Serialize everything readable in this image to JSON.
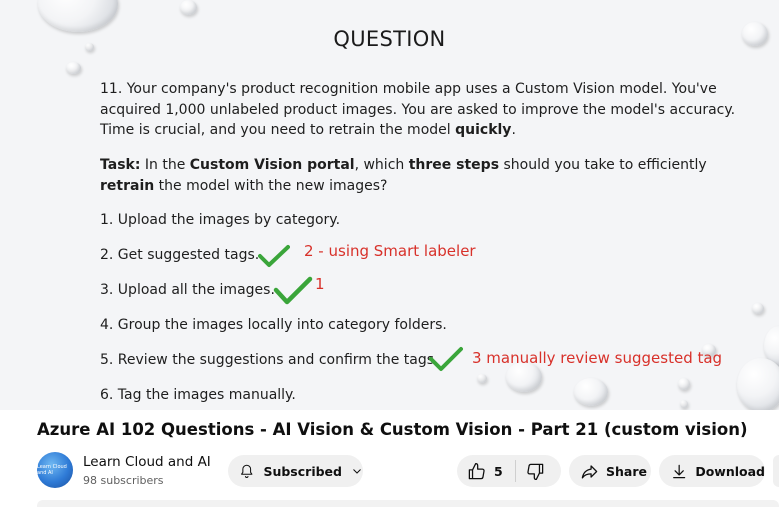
{
  "video_frame": {
    "heading": "QUESTION",
    "question_parts": [
      {
        "text": "11. Your company's product recognition mobile app uses a Custom Vision model. You've acquired 1,000 unlabeled product images. You are asked to improve the model's accuracy. Time is crucial, and you need to retrain the model ",
        "bold": false
      },
      {
        "text": "quickly",
        "bold": true
      },
      {
        "text": ".",
        "bold": false
      }
    ],
    "task_parts": [
      {
        "text": "Task:",
        "bold": true
      },
      {
        "text": " In the ",
        "bold": false
      },
      {
        "text": "Custom Vision portal",
        "bold": true
      },
      {
        "text": ", which ",
        "bold": false
      },
      {
        "text": "three steps",
        "bold": true
      },
      {
        "text": " should you take to efficiently ",
        "bold": false
      },
      {
        "text": "retrain",
        "bold": true
      },
      {
        "text": " the model with the new images?",
        "bold": false
      }
    ],
    "steps": [
      "1. Upload the images by category.",
      "2.  Get suggested tags.",
      "3.  Upload all the images.",
      "4.  Group the images locally into category folders.",
      "5.  Review the suggestions and confirm the tags.",
      "6.  Tag the images manually."
    ],
    "annotations": {
      "step2": "2 - using Smart labeler",
      "step3": "1",
      "step5": "3 manually review suggested tag"
    },
    "check_color": "#3aa53a",
    "note_color": "#d8312a"
  },
  "video_title": "Azure AI 102 Questions - AI Vision & Custom Vision - Part 21 (custom vision)",
  "channel": {
    "name": "Learn Cloud and AI",
    "subscribers": "98 subscribers",
    "avatar_text": "Learn Cloud and AI"
  },
  "actions": {
    "subscribed_label": "Subscribed",
    "like_count": "5",
    "share_label": "Share",
    "download_label": "Download"
  }
}
